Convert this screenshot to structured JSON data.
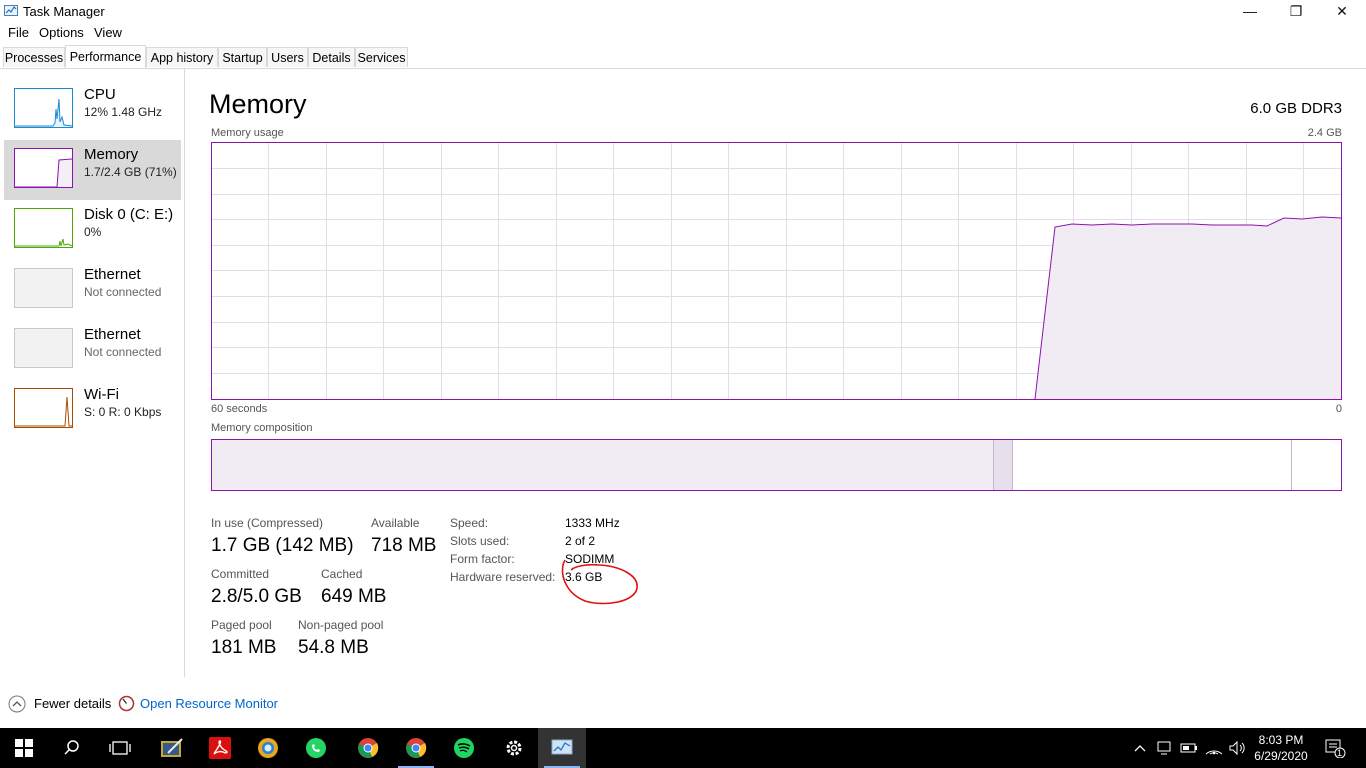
{
  "window": {
    "title": "Task Manager",
    "minimize": "—",
    "maximize": "❐",
    "close": "✕"
  },
  "menu": [
    "File",
    "Options",
    "View"
  ],
  "tabs": [
    "Processes",
    "Performance",
    "App history",
    "Startup",
    "Users",
    "Details",
    "Services"
  ],
  "active_tab": "Performance",
  "sidebar": {
    "items": [
      {
        "name": "CPU",
        "sub": "12% 1.48 GHz",
        "color": "#1b8ad3"
      },
      {
        "name": "Memory",
        "sub": "1.7/2.4 GB (71%)",
        "color": "#8b12ae"
      },
      {
        "name": "Disk 0 (C: E:)",
        "sub": "0%",
        "color": "#4da60c"
      },
      {
        "name": "Ethernet",
        "sub": "Not connected",
        "color": "#a0a0a0"
      },
      {
        "name": "Ethernet",
        "sub": "Not connected",
        "color": "#a0a0a0"
      },
      {
        "name": "Wi-Fi",
        "sub": "S: 0 R: 0 Kbps",
        "color": "#a74f01"
      }
    ]
  },
  "main": {
    "title": "Memory",
    "total": "6.0 GB DDR3",
    "usage_label": "Memory usage",
    "usage_max": "2.4 GB",
    "time_left": "60 seconds",
    "time_right": "0",
    "composition_label": "Memory composition",
    "accent": "#8b12ae",
    "stats": {
      "in_use_label": "In use (Compressed)",
      "in_use_value": "1.7 GB (142 MB)",
      "available_label": "Available",
      "available_value": "718 MB",
      "committed_label": "Committed",
      "committed_value": "2.8/5.0 GB",
      "cached_label": "Cached",
      "cached_value": "649 MB",
      "paged_label": "Paged pool",
      "paged_value": "181 MB",
      "nonpaged_label": "Non-paged pool",
      "nonpaged_value": "54.8 MB"
    },
    "details": [
      {
        "label": "Speed:",
        "value": "1333 MHz"
      },
      {
        "label": "Slots used:",
        "value": "2 of 2"
      },
      {
        "label": "Form factor:",
        "value": "SODIMM"
      },
      {
        "label": "Hardware reserved:",
        "value": "3.6 GB"
      }
    ]
  },
  "footer": {
    "fewer_details": "Fewer details",
    "open_resource_monitor": "Open Resource Monitor"
  },
  "taskbar": {
    "time": "8:03 PM",
    "date": "6/29/2020",
    "notification_count": "1",
    "icons": [
      "windows-start-icon",
      "search-icon",
      "task-view-icon",
      "app-icon",
      "acrobat-icon",
      "chrome-canary-icon",
      "whatsapp-icon",
      "chrome-icon",
      "chrome-icon",
      "spotify-icon",
      "settings-gear-icon",
      "task-manager-icon"
    ]
  }
}
